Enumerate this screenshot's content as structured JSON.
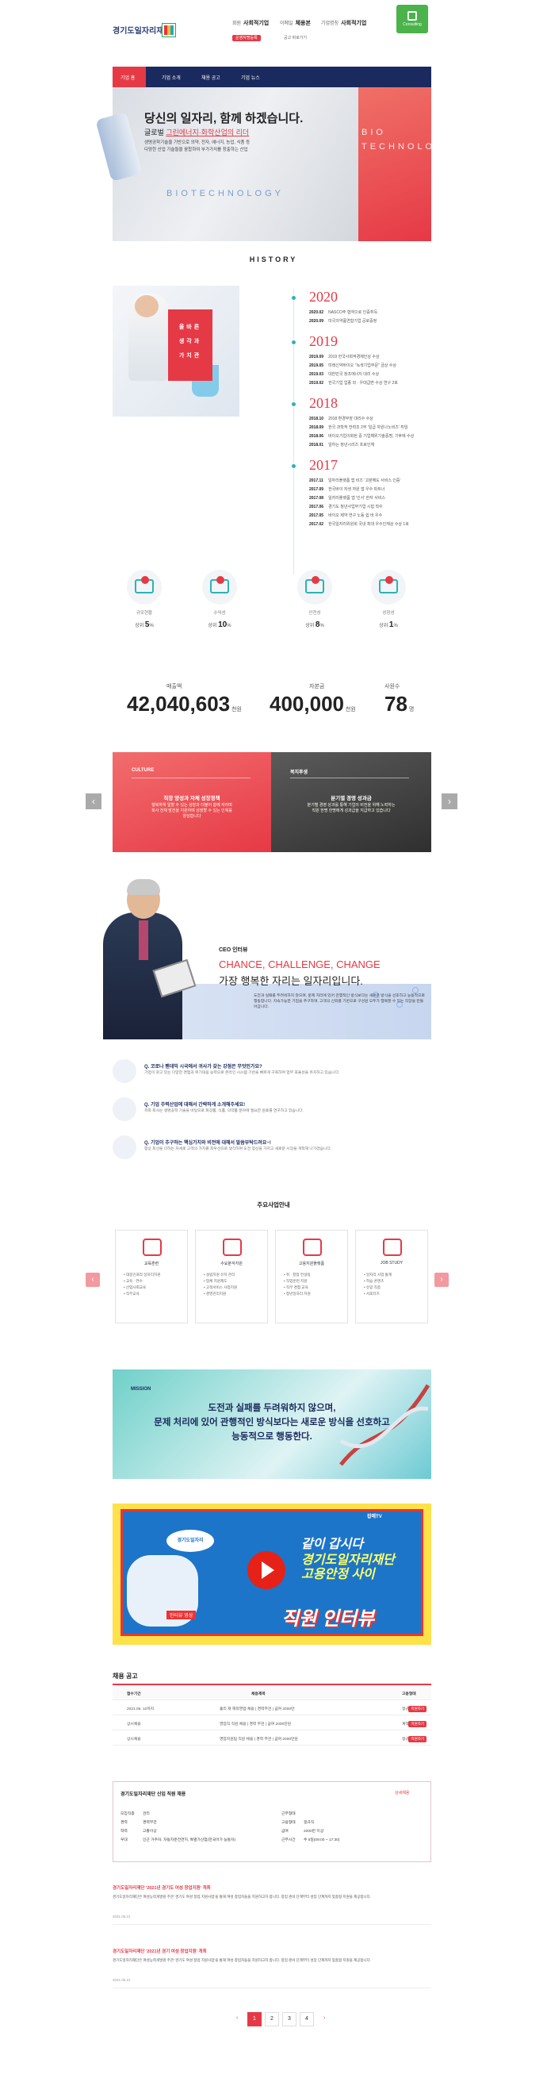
{
  "header": {
    "logo_text": "경기도일자리재단",
    "nav": [
      {
        "label": "회원",
        "value": "사회적기업"
      },
      {
        "label": "이메일",
        "value": "체용본"
      },
      {
        "label": "기업명칭",
        "value": "사회적기업"
      }
    ],
    "sub_links": [
      "운영자명등록",
      "공고 바로가기"
    ],
    "consult_label": "Consulting"
  },
  "navbar": {
    "items": [
      "기업 홈",
      "기업 소개",
      "채용 공고",
      "기업 뉴스"
    ]
  },
  "hero": {
    "title": "당신의 일자리, 함께 하겠습니다.",
    "subtitle_pre": "글로벌 ",
    "subtitle_highlight": "그린에너지·화학산업의 리더",
    "desc": "생명공학기술을 기반으로 의약, 전자, 에너지, 농업, 식품 등\n다양한 산업 기술들을 융합하여 부가가치를 창출하는 산업",
    "side_text": "BIO\nTECHNOLOGY",
    "bg_text": "BIOTECHNOLOGY"
  },
  "history": {
    "title": "HISTORY",
    "box_text": "올바른\n생각과\n가치관",
    "years": [
      {
        "year": "2020",
        "events": [
          {
            "date": "2020.02",
            "text": "NASCO주 협약으로 인증취득"
          },
          {
            "date": "2020.09",
            "text": "미국의약품연합기업 공로증정"
          }
        ]
      },
      {
        "year": "2019",
        "events": [
          {
            "date": "2019.09",
            "text": "2019 한국사회적경제인상 수상"
          },
          {
            "date": "2019.05",
            "text": "미래신약바이오 \"녹색기업부문\" 금상 수상"
          },
          {
            "date": "2019.03",
            "text": "대한민국 창조에너지 대리 수상"
          },
          {
            "date": "2019.02",
            "text": "한국기업 업종 외 · 우대급변 수상 연구 2호"
          }
        ]
      },
      {
        "year": "2018",
        "events": [
          {
            "date": "2018.10",
            "text": "2018 환경부장 대리수 수상"
          },
          {
            "date": "2018.09",
            "text": "한국 과학적 전력조 2부 '일급 자원나노비즈' 취임"
          },
          {
            "date": "2018.06",
            "text": "바이오기업이화된 중 기업해위기술증명, 기후에 수상"
          },
          {
            "date": "2018.01",
            "text": "일하는 청년시리즈 프로인재"
          }
        ]
      },
      {
        "year": "2017",
        "events": [
          {
            "date": "2017.11",
            "text": "일자리플랫폼 앱 비즈 '고분해도 서비스 인증'"
          },
          {
            "date": "2017.09",
            "text": "한국바이 자생 자원 앱 우수 파트너"
          },
          {
            "date": "2017.08",
            "text": "일자리플랫폼 앱 '인사' 한자 서비스"
          },
          {
            "date": "2017.06",
            "text": "경기도 청년사업부기업 시험 착수"
          },
          {
            "date": "2017.05",
            "text": "바이오 제약 연구 노동 쉽 바 우수"
          },
          {
            "date": "2017.02",
            "text": "한국일자리위원회 국내 최대 우수인재상 수상 1호"
          }
        ]
      }
    ]
  },
  "stats": {
    "growth": [
      {
        "label": "규모현황",
        "prefix": "상위",
        "value": "5",
        "unit": "%"
      },
      {
        "label": "수익성",
        "prefix": "상위",
        "value": "10",
        "unit": "%"
      },
      {
        "label": "안전성",
        "prefix": "상위",
        "value": "8",
        "unit": "%"
      },
      {
        "label": "성장성",
        "prefix": "상위",
        "value": "1",
        "unit": "%"
      }
    ],
    "figures": [
      {
        "label": "매출액",
        "value": "42,040,603",
        "unit": "천원"
      },
      {
        "label": "자본금",
        "value": "400,000",
        "unit": "천원"
      },
      {
        "label": "사원수",
        "value": "78",
        "unit": "명"
      }
    ]
  },
  "culture": {
    "left": {
      "tag": "CULTURE",
      "title": "직장 양성과 자체 성장정책",
      "desc": "행복하게 일할 수 있는 성장과 더불어 함께 자라며\n회사 전체 발전을 지원하며 성장할 수 있는 인재를\n양성합니다"
    },
    "right": {
      "tag": "복지후생",
      "title": "분기별 경영 성과금",
      "desc": "분기별 경영 성과를 통해 기업의 비전을 위해 노력하는\n직원 한명 한명에게 성과급을 지급하고 있습니다"
    }
  },
  "ceo": {
    "label": "CEO 인터뷰",
    "line1": "CHANCE, CHALLENGE, CHANGE",
    "line2": "가장 행복한 자리는 일자리입니다.",
    "desc": "도전과 실패를 두려워하지 않으며, 문제 처리에 있어 관행적인 방식보다는 새로운 방식을 선호하고 능동적으로 행동합니다. 지속가능한 기업을 추구하며, 고객의 신뢰를 기반으로 구성원 모두가 행복할 수 있는 직장을 만들어갑니다."
  },
  "qa": [
    {
      "q": "Q. 코로나 팬데믹 시국에서 귀사가 갖는 강점은 무엇인가요?",
      "a": "기업이 갖고 있는 다양한 경험과 위기대응 능력으로 온라인 시스템 기반을 빠르게 구축하여 업무 효율성을 유지하고 있습니다."
    },
    {
      "q": "Q. 기업 주력산업에 대해서 간략하게 소개해주세요!",
      "a": "저희 회사는 생명공학 기술을 바탕으로 화장품, 식품, 의약품 분야에 필요한 원료를 연구하고 있습니다."
    },
    {
      "q": "Q. 기업이 추구하는 핵심가치와 비전에 대해서 말씀부탁드려요~!",
      "a": "항상 최선을 다하는 자세로 고객의 가치를 최우선으로 생각하며 도전 정신을 가지고 새로운 시장을 개척해 나가겠습니다."
    }
  ],
  "business": {
    "title": "주요사업안내",
    "cards": [
      {
        "title": "교육훈련",
        "items": [
          "대중인프라 일자리지원",
          "교육 · 연수",
          "산업사회교육",
          "직무교육"
        ]
      },
      {
        "title": "수요분석지원",
        "items": [
          "설립지원 유지 관리",
          "업체 지원제도",
          "고객서비스 사업지원",
          "경영관리지원"
        ]
      },
      {
        "title": "고용지원플랫폼",
        "items": [
          "취 · 창업 컨설팅",
          "직업훈련 지원",
          "직무 경험 교육",
          "청년일자리 지원"
        ]
      },
      {
        "title": "JOB STUDY",
        "items": [
          "일자리 사업 통계",
          "학습 콘텐츠",
          "유망 직종",
          "서포터즈"
        ]
      }
    ]
  },
  "mission": {
    "label": "MISSION",
    "line1": "도전과 실패를 두려워하지 않으며,",
    "line2": "문제 처리에 있어 관행적인 방식보다는 새로운 방식을 선호하고",
    "line3": "능동적으로 행동한다."
  },
  "video": {
    "badge": "경기도일자리",
    "line1": "같이 갑시다",
    "line2": "경기도일자리재단",
    "line3": "고용안정 사이",
    "title": "직원 인터뷰",
    "tag": "잡매TV",
    "caption": "인터뷰 영상"
  },
  "recruit": {
    "title": "채용 공고",
    "headers": [
      "접수기간",
      "채용제목",
      "고용형태"
    ],
    "rows": [
      {
        "period": "2021.05. 10까지",
        "title": "횰리 재 해외영업 채용 | 경력무관 | 급여 2000만",
        "type": "정규직",
        "btn": "지원하기"
      },
      {
        "period": "상시채용",
        "title": "영업직 직원 채용 | 경력 무관 | 급여 2000만원",
        "type": "계약직",
        "btn": "지원하기"
      },
      {
        "period": "상시채용",
        "title": "영업지원팀 직원 채용 | 경력 무관 | 급여 2000만원",
        "type": "정규직",
        "btn": "지원하기"
      }
    ],
    "detail": {
      "title": "경기도일자리재단 신입 직원 채용",
      "link": "상세채용",
      "left": [
        {
          "k": "모집직종",
          "v": "관리"
        },
        {
          "k": "경력",
          "v": "경력무관"
        },
        {
          "k": "학력",
          "v": "고졸이상"
        },
        {
          "k": "우대",
          "v": "인근 거주자, 자동차운전면허, 특별가산점(한국어가 능통자)"
        }
      ],
      "right": [
        {
          "k": "근무형태",
          "v": ""
        },
        {
          "k": "고용형태",
          "v": "정규직"
        },
        {
          "k": "급여",
          "v": "2200만 이상"
        },
        {
          "k": "근무시간",
          "v": "주 5일(09:00 ~ 17:30)"
        }
      ]
    }
  },
  "posts": [
    {
      "title": "경기도일자리재단 '2021년 경기도 여성 창업지원' 개최",
      "desc": "경기도일자리재단은 여성능력개발원 주관 '경기도 여성 창업 지원사업'을 통해 여성 창업자들을 지원하고자 합니다. 창업 준비 단계부터 성장 단계까지 맞춤형 지원을 제공합니다.",
      "date": "2021.05.21"
    },
    {
      "title": "경기도일자리재단 '2021년 경기 여성 창업지원' 개최",
      "desc": "경기도일자리재단은 여성능력개발원 주관 '경기도 여성 창업 지원사업'을 통해 여성 창업자들을 지원하고자 합니다. 창업 준비 단계부터 성장 단계까지 맞춤형 지원을 제공합니다.",
      "date": "2021.05.21"
    }
  ],
  "pagination": {
    "prev": "‹",
    "pages": [
      "1",
      "2",
      "3",
      "4"
    ],
    "next": "›"
  },
  "colors": {
    "accent": "#e63946",
    "navy": "#1a2a5e",
    "teal": "#2bb3b9"
  }
}
